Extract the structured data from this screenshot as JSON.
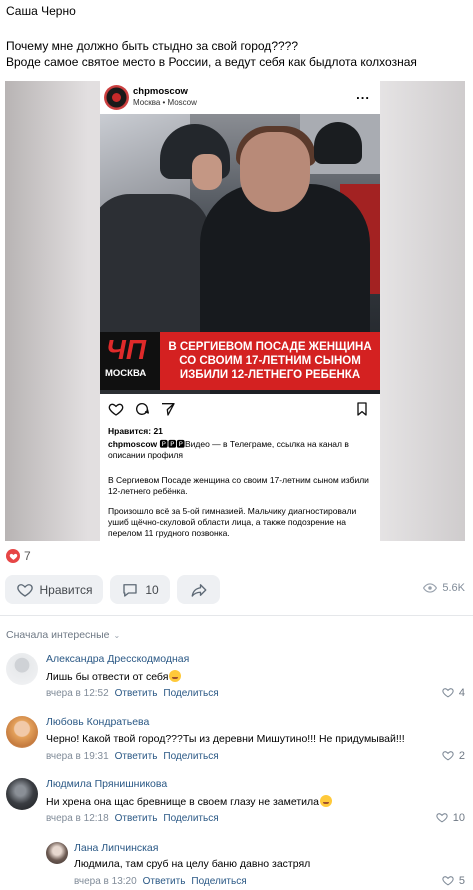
{
  "post": {
    "author": "Саша Черно",
    "text_line1": "Почему мне должно быть стыдно за свой город????",
    "text_line2": "Вроде самое святое место в России, а ведут себя как быдлота колхозная"
  },
  "embed": {
    "username": "chpmoscow",
    "location": "Москва • Moscow",
    "more": "...",
    "logo_big": "ЧП",
    "logo_small": "МОСКВА",
    "headline": "В СЕРГИЕВОМ ПОСАДЕ ЖЕНЩИНА\nСО СВОИМ 17-ЛЕТНИМ СЫНОМ\nИЗБИЛИ 12-ЛЕТНЕГО РЕБЕНКА",
    "likes": "Нравится: 21",
    "caption_user": "chpmoscow",
    "caption_text": " 🅿🅿🅿Видео — в Телеграме, ссылка на канал в описании профиля",
    "para1": "В Сергиевом Посаде женщина со своим 17-летним сыном избили 12-летнего ребёнка.",
    "para2": "Произошло всё за 5-ой гимназией. Мальчику диагностировали ушиб щёчно-скуловой области лица, а также подозрение на перелом 11 грудного позвонка."
  },
  "reactions": {
    "count": "7"
  },
  "actions": {
    "like_label": "Нравится",
    "comment_count": "10",
    "views": "5.6K"
  },
  "comments_sort": "Сначала интересные",
  "comments": [
    {
      "name": "Александра Дресскодмодная",
      "text": "Лишь бы отвести от себя",
      "time": "вчера в 12:52",
      "reply": "Ответить",
      "share": "Поделиться",
      "likes": "4"
    },
    {
      "name": "Любовь Кондратьева",
      "text": "Черно! Какой твой город???Ты из деревни Мишутино!!! Не придумывай!!!",
      "time": "вчера в 19:31",
      "reply": "Ответить",
      "share": "Поделиться",
      "likes": "2"
    },
    {
      "name": "Людмила Прянишникова",
      "text": "Ни хрена она щас бревнище в своем глазу не заметила",
      "time": "вчера в 12:18",
      "reply": "Ответить",
      "share": "Поделиться",
      "likes": "10"
    },
    {
      "name": "Лана Липчинская",
      "text": "Людмила, там сруб на целу баню давно застрял",
      "time": "вчера в 13:20",
      "reply": "Ответить",
      "share": "Поделиться",
      "likes": "5"
    }
  ],
  "colors": {
    "link": "#2a5885",
    "accent_red": "#d42121",
    "button_bg": "#eef0f3"
  }
}
